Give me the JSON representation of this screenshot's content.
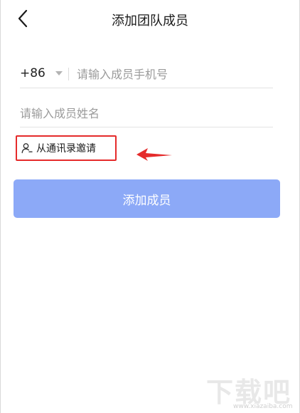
{
  "header": {
    "title": "添加团队成员"
  },
  "phone": {
    "country_code": "+86",
    "placeholder": "请输入成员手机号"
  },
  "name": {
    "placeholder": "请输入成员姓名"
  },
  "invite": {
    "label": "从通讯录邀请"
  },
  "submit": {
    "label": "添加成员"
  },
  "watermark": {
    "logo": "下载吧",
    "url": "www.xiazaiba.com"
  },
  "colors": {
    "button": "#8ca9f7",
    "highlight": "#e52b2b"
  }
}
